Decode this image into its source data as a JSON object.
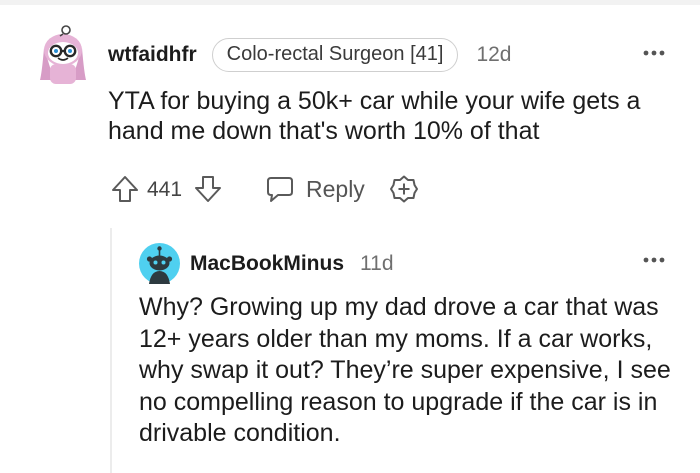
{
  "comment": {
    "username": "wtfaidhfr",
    "flair": "Colo-rectal Surgeon [41]",
    "age": "12d",
    "body": "YTA for buying a 50k+ car while your wife gets a hand me down that's worth 10% of that",
    "votes": "441",
    "reply_label": "Reply",
    "more_icon": "more-horizontal-icon"
  },
  "reply": {
    "username": "MacBookMinus",
    "age": "11d",
    "body": "Why? Growing up my dad drove a car that was 12+ years older than my moms. If a car works, why swap it out? They’re super expensive, I see no compelling reason to upgrade if the car is in drivable condition.",
    "more_icon": "more-horizontal-icon"
  },
  "colors": {
    "text": "#1c1c1c",
    "muted": "#6f6f6f",
    "flair_border": "#cfcfcf",
    "avatar_bg": "#e6b3d6",
    "avatar2_bg": "#4fd0f0",
    "thread_line": "#ececec"
  }
}
